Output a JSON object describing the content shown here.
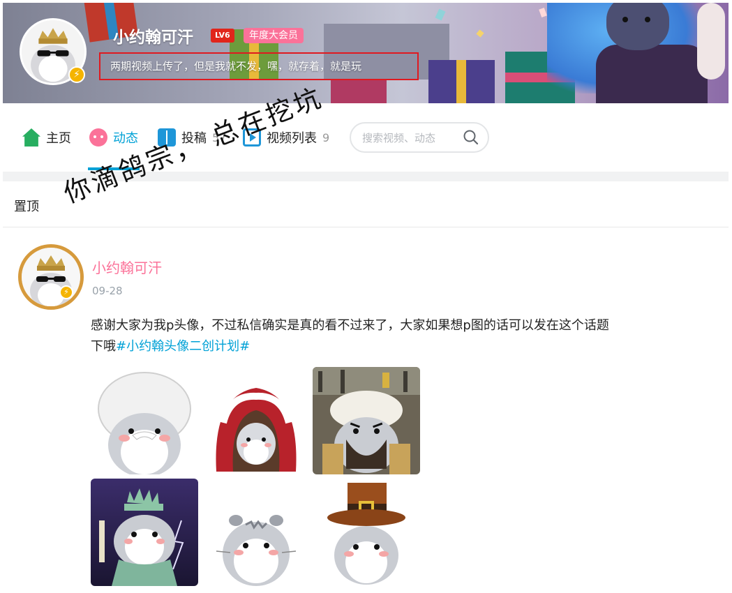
{
  "header": {
    "username": "小约翰可汗",
    "level_badge": "LV6",
    "vip_badge": "年度大会员",
    "signature": "两期视频上传了，但是我就不发，嘿，就存着，就是玩",
    "avatar_badge_icon": "lightning-icon"
  },
  "nav": {
    "tabs": [
      {
        "label": "主页",
        "icon": "home-icon"
      },
      {
        "label": "动态",
        "icon": "dynamic-icon",
        "active": true
      },
      {
        "label": "投稿",
        "icon": "posts-icon",
        "count": "57"
      },
      {
        "label": "视频列表",
        "icon": "video-list-icon",
        "count": "9"
      }
    ],
    "search_placeholder": "搜索视频、动态"
  },
  "pinned": {
    "label": "置顶"
  },
  "overlay_caption": "你滴鸽宗， 总在挖坑",
  "post": {
    "author": "小约翰可汗",
    "date": "09-28",
    "text": "感谢大家为我p头像，不过私信确实是真的看不过来了，大家如果想p图的话可以发在这个话题下哦",
    "topic": "#小约翰头像二创计划#",
    "images": [
      {
        "name": "hamster-white-wig"
      },
      {
        "name": "hamster-red-hood"
      },
      {
        "name": "hamster-fur-hat-army"
      },
      {
        "name": "hamster-statue-of-liberty"
      },
      {
        "name": "hamster-plain"
      },
      {
        "name": "hamster-pilgrim-hat"
      }
    ]
  },
  "colors": {
    "accent": "#00a1d6",
    "pink": "#fb7299",
    "level_red": "#e1251b",
    "highlight_box": "#e0191f"
  }
}
